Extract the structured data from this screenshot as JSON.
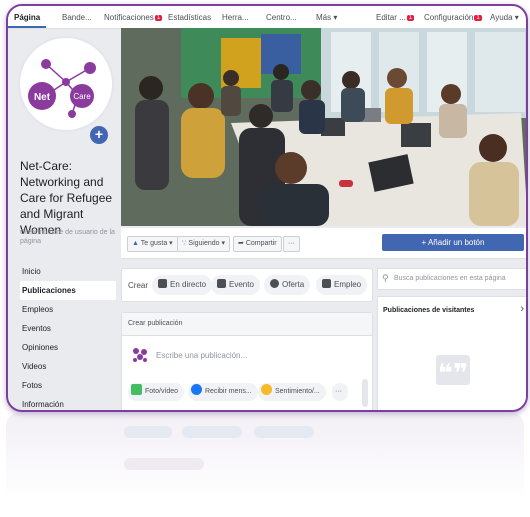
{
  "topbar": {
    "tabs": [
      {
        "label": "Página",
        "active": true
      },
      {
        "label": "Bande...",
        "active": false
      },
      {
        "label": "Notificaciones",
        "badge": "1",
        "active": false
      },
      {
        "label": "Estadísticas",
        "active": false
      },
      {
        "label": "Herra...",
        "active": false
      },
      {
        "label": "Centro...",
        "active": false
      },
      {
        "label": "Más ▾",
        "active": false
      }
    ],
    "right": [
      {
        "label": "Editar ...",
        "badge": "1"
      },
      {
        "label": "Configuración",
        "badge": "1"
      },
      {
        "label": "Ayuda ▾"
      }
    ]
  },
  "profile": {
    "logo_left": "Net",
    "logo_right": "Care",
    "add_icon": "plus-icon",
    "page_name": "Net-Care: Networking and Care for Refugee and Migrant Women",
    "username_hint": "Crear nombre de usuario de la página"
  },
  "nav": {
    "items": [
      {
        "label": "Inicio",
        "active": false
      },
      {
        "label": "Publicaciones",
        "active": true
      },
      {
        "label": "Empleos",
        "active": false
      },
      {
        "label": "Eventos",
        "active": false
      },
      {
        "label": "Opiniones",
        "active": false
      },
      {
        "label": "Videos",
        "active": false
      },
      {
        "label": "Fotos",
        "active": false
      },
      {
        "label": "Información",
        "active": false
      }
    ]
  },
  "actions": {
    "like": "Te gusta ▾",
    "follow": "Siguiendo ▾",
    "share": "Compartir",
    "more": "···",
    "add_button": "+ Añadir un botón"
  },
  "create": {
    "label": "Crear",
    "options": [
      "En directo",
      "Evento",
      "Oferta",
      "Empleo"
    ]
  },
  "post": {
    "header": "Crear publicación",
    "placeholder": "Escribe una publicación...",
    "options": [
      "Foto/vídeo",
      "Recibir mens...",
      "Sentimiento/...",
      "···"
    ]
  },
  "sidebar_right": {
    "search_placeholder": "Busca publicaciones en esta página",
    "visitors_title": "Publicaciones de visitantes",
    "quote_glyph": "❝❞"
  },
  "colors": {
    "brand_blue": "#4267b2",
    "frame_purple": "#7b3fa0",
    "badge_red": "#e41e3f",
    "logo_purple": "#8b3a9e"
  }
}
